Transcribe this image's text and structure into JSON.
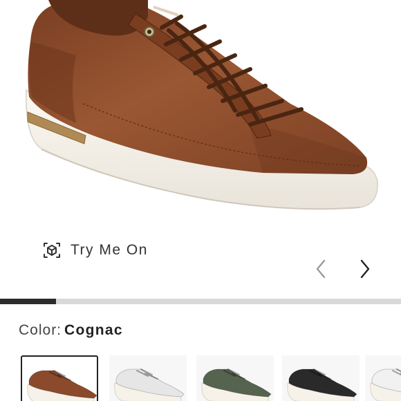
{
  "product": {
    "image_alt": "Cognac leather low-top sneaker with white sole"
  },
  "try_on": {
    "label": "Try Me On",
    "icon": "ar-cube-icon"
  },
  "gallery": {
    "prev_icon": "chevron-left-icon",
    "next_icon": "chevron-right-icon",
    "progress": 0.14
  },
  "color": {
    "label": "Color:",
    "value": "Cognac"
  },
  "swatches": [
    {
      "name": "Cognac",
      "upper": "#8a4a2b",
      "selected": true
    },
    {
      "name": "Light",
      "upper": "#e6e6e6",
      "selected": false
    },
    {
      "name": "Green",
      "upper": "#56634f",
      "selected": false
    },
    {
      "name": "Black",
      "upper": "#2a2a2a",
      "selected": false
    },
    {
      "name": "White",
      "upper": "#f1f1f1",
      "selected": false
    }
  ],
  "colors": {
    "accent": "#2b2b2b",
    "track": "#d9d9d9",
    "leather": "#8a4a2b"
  }
}
